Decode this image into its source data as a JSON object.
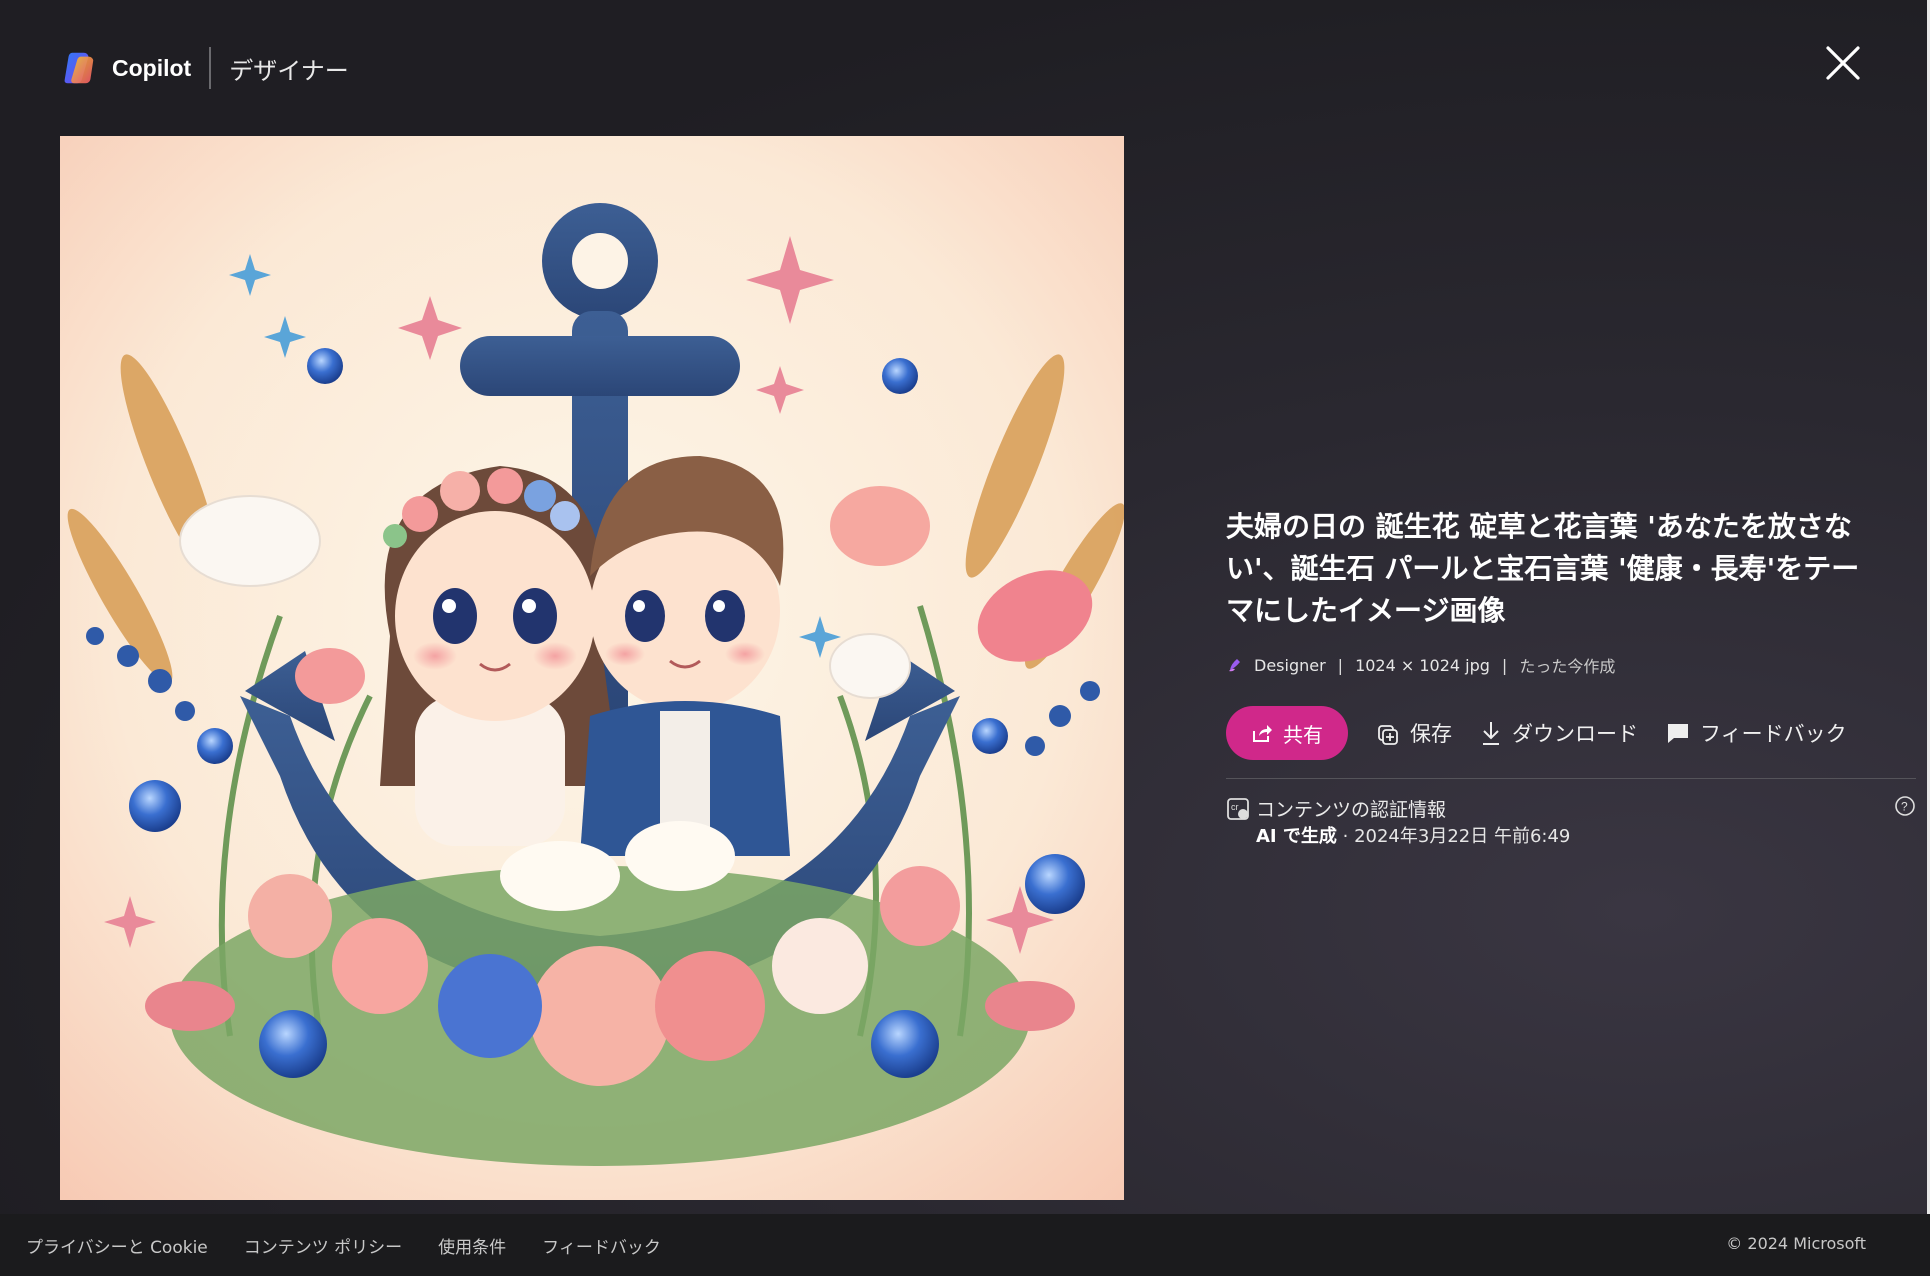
{
  "header": {
    "brand": "Copilot",
    "product": "デザイナー"
  },
  "panel": {
    "title": "夫婦の日の 誕生花 碇草と花言葉 'あなたを放さない'、誕生石 パールと宝石言葉 '健康・長寿'をテーマにしたイメージ画像",
    "meta": {
      "app": "Designer",
      "size": "1024 × 1024 jpg",
      "created": "たった今作成"
    },
    "actions": {
      "share": "共有",
      "save": "保存",
      "download": "ダウンロード",
      "feedback": "フィードバック"
    },
    "credentials": {
      "title": "コンテンツの認証情報",
      "ai_label": "AI で生成",
      "date": " · 2024年3月22日 午前6:49"
    }
  },
  "footer": {
    "links": [
      "プライバシーと Cookie",
      "コンテンツ ポリシー",
      "使用条件",
      "フィードバック"
    ],
    "copyright": "© 2024 Microsoft"
  },
  "colors": {
    "accent": "#d0288a",
    "background": "#1e1e21"
  }
}
